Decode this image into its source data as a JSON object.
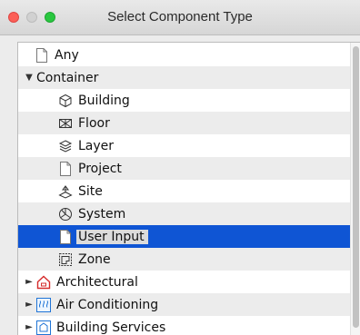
{
  "window": {
    "title": "Select Component Type"
  },
  "tree": [
    {
      "label": "Any",
      "icon": "document-icon",
      "level": 1
    },
    {
      "label": "Container",
      "icon": "",
      "level": 0,
      "disclosure": "▼"
    },
    {
      "label": "Building",
      "icon": "cube-icon",
      "level": 2
    },
    {
      "label": "Floor",
      "icon": "floor-icon",
      "level": 2
    },
    {
      "label": "Layer",
      "icon": "layers-icon",
      "level": 2
    },
    {
      "label": "Project",
      "icon": "document-icon",
      "level": 2
    },
    {
      "label": "Site",
      "icon": "site-icon",
      "level": 2
    },
    {
      "label": "System",
      "icon": "system-icon",
      "level": 2
    },
    {
      "label": "User Input",
      "icon": "document-icon",
      "level": 2,
      "selected": true
    },
    {
      "label": "Zone",
      "icon": "zone-icon",
      "level": 2
    },
    {
      "label": "Architectural",
      "icon": "house-icon",
      "level": 0,
      "disclosure": "►"
    },
    {
      "label": "Air Conditioning",
      "icon": "air-conditioning-icon",
      "level": 0,
      "disclosure": "►"
    },
    {
      "label": "Building Services",
      "icon": "building-services-icon",
      "level": 0,
      "disclosure": "►"
    }
  ],
  "colors": {
    "selection": "#0f55d4",
    "alt_row": "#ececec",
    "category_icon": "#d62b2b",
    "ac_icon": "#1f74d6"
  }
}
